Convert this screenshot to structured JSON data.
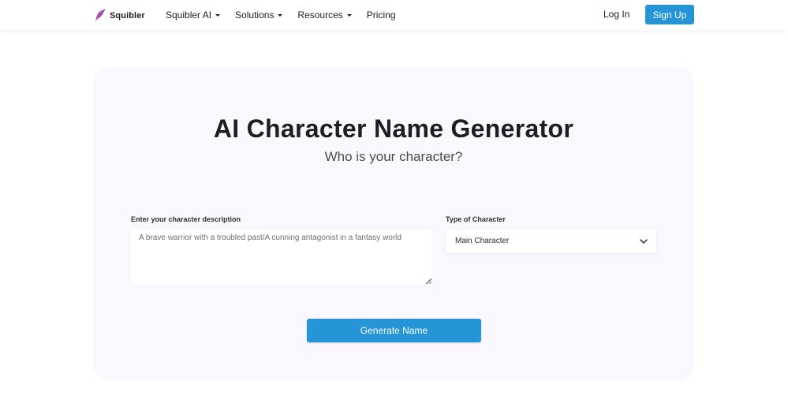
{
  "header": {
    "brand": "Squibler",
    "logo_icon": "quill-feather-icon",
    "nav": [
      {
        "label": "Squibler AI",
        "has_dropdown": true
      },
      {
        "label": "Solutions",
        "has_dropdown": true
      },
      {
        "label": "Resources",
        "has_dropdown": true
      },
      {
        "label": "Pricing",
        "has_dropdown": false
      }
    ],
    "login_label": "Log In",
    "signup_label": "Sign Up"
  },
  "main": {
    "title": "AI Character Name Generator",
    "subtitle": "Who is your character?",
    "description": {
      "label": "Enter your character description",
      "placeholder": "A brave warrior with a troubled past/A cunning antagonist in a fantasy world",
      "value": ""
    },
    "type": {
      "label": "Type of Character",
      "selected": "Main Character"
    },
    "generate_label": "Generate Name"
  },
  "colors": {
    "accent": "#2595d8",
    "card_background": "#f8f8fe",
    "text": "#1d1d22"
  }
}
